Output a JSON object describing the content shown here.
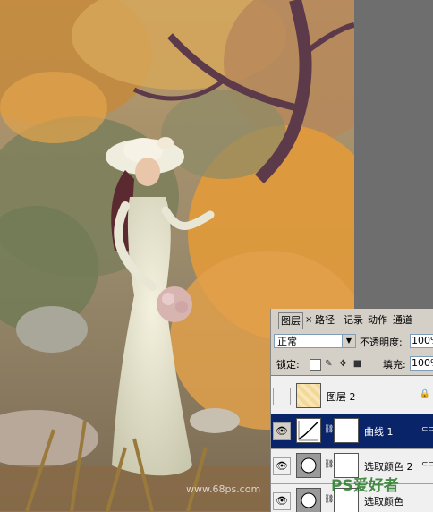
{
  "panel": {
    "tabs": [
      "图层",
      "路径",
      "记录",
      "动作",
      "通道"
    ],
    "close_glyph": "×",
    "blend_mode": "正常",
    "opacity_label": "不透明度:",
    "opacity_value": "100%",
    "lock_label": "锁定:",
    "fill_label": "填充:",
    "fill_value": "100%",
    "layers": [
      {
        "name": "图层 2",
        "visible": false,
        "selected": false
      },
      {
        "name": "曲线 1",
        "visible": true,
        "selected": true
      },
      {
        "name": "选取颜色 2",
        "visible": true,
        "selected": false
      },
      {
        "name": "选取颜色",
        "visible": true,
        "selected": false
      }
    ]
  },
  "watermark": {
    "left": "www.68ps.com",
    "right": "PS爱好者"
  },
  "colors": {
    "selected_layer": "#0a246a",
    "panel_bg": "#d4d0c8",
    "foliage_orange": "#e29a3a",
    "foliage_green": "#6f7a55"
  }
}
